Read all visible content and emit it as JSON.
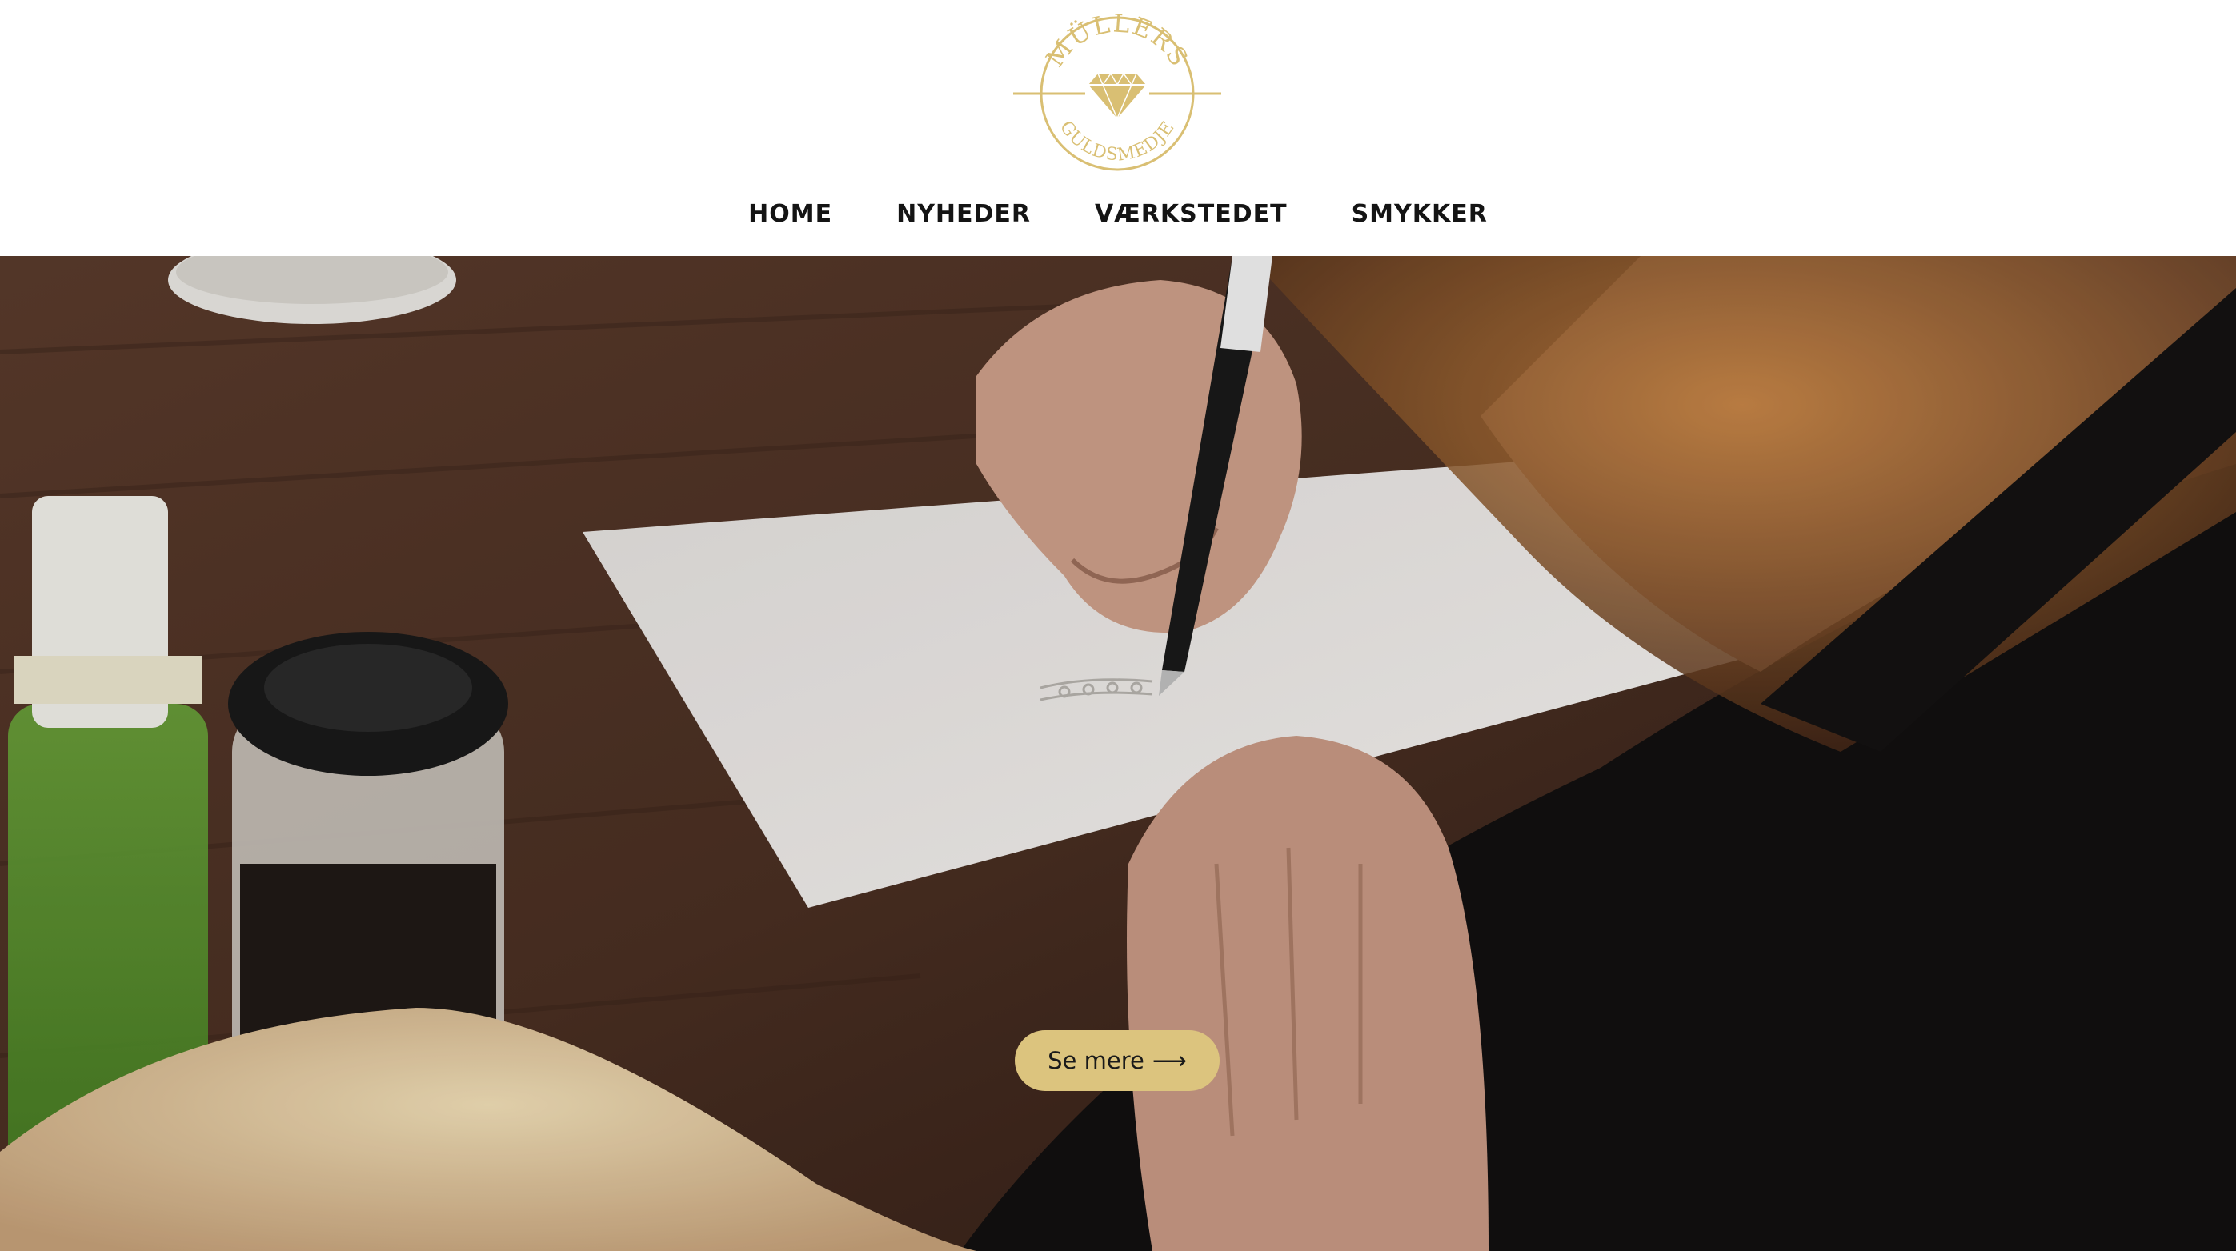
{
  "brand": {
    "logo_top_text": "MÜLLERS",
    "logo_bottom_text": "GULDSMEDJE",
    "accent_color": "#d9bf73",
    "icon": "diamond-icon"
  },
  "nav": {
    "items": [
      {
        "label": "HOME"
      },
      {
        "label": "NYHEDER"
      },
      {
        "label": "VÆRKSTEDET"
      },
      {
        "label": "SMYKKER"
      }
    ]
  },
  "hero": {
    "image": "goldsmith-sketching-jewelry",
    "cta_label": "Se mere",
    "cta_arrow": "⟶",
    "cta_color": "#dcc47e"
  }
}
